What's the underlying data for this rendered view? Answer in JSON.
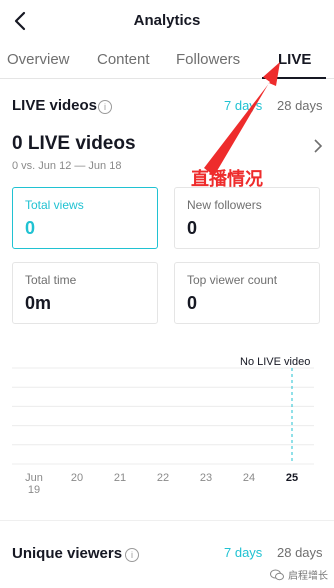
{
  "header": {
    "title": "Analytics"
  },
  "tabs": [
    {
      "label": "Overview"
    },
    {
      "label": "Content"
    },
    {
      "label": "Followers"
    },
    {
      "label": "LIVE"
    }
  ],
  "live": {
    "section_title": "LIVE videos",
    "ranges": [
      "7 days",
      "28 days"
    ],
    "headline": "0 LIVE videos",
    "comparison": "0 vs. Jun 12 — Jun 18",
    "cards": [
      {
        "label": "Total views",
        "value": "0"
      },
      {
        "label": "New followers",
        "value": "0"
      },
      {
        "label": "Total time",
        "value": "0m"
      },
      {
        "label": "Top viewer count",
        "value": "0"
      }
    ]
  },
  "annotation": {
    "text": "直播情况"
  },
  "chart_data": {
    "type": "line",
    "categories": [
      "Jun 19",
      "20",
      "21",
      "22",
      "23",
      "24",
      "25"
    ],
    "values": [
      0,
      0,
      0,
      0,
      0,
      0,
      0
    ],
    "annotation": "No LIVE video",
    "grid": true
  },
  "unique": {
    "section_title": "Unique viewers",
    "ranges": [
      "7 days",
      "28 days"
    ]
  },
  "watermark": {
    "text": "启程增长"
  },
  "colors": {
    "accent": "#20c2d2",
    "annotation": "#ee2c2c",
    "text": "#161823"
  }
}
